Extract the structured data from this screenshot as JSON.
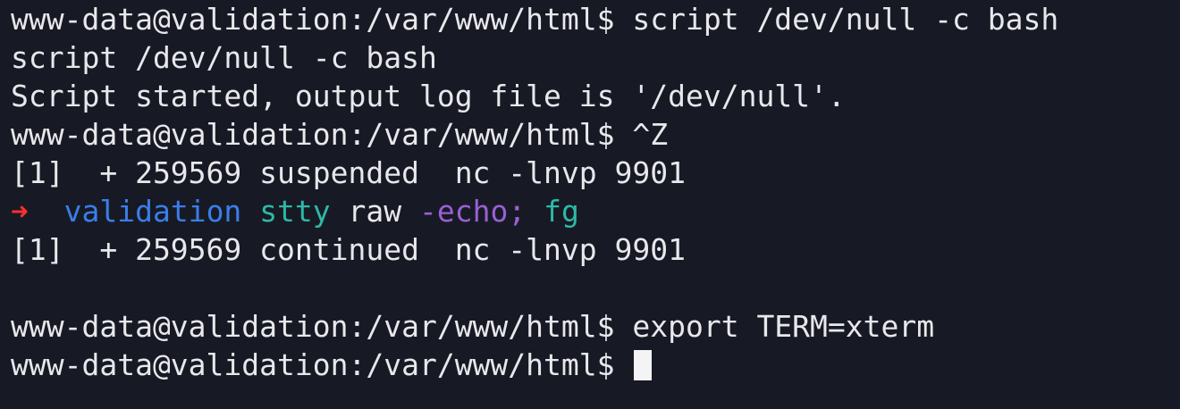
{
  "terminal": {
    "lines": [
      "www-data@validation:/var/www/html$ script /dev/null -c bash",
      "script /dev/null -c bash",
      "Script started, output log file is '/dev/null'.",
      "www-data@validation:/var/www/html$ ^Z",
      "[1]  + 259569 suspended  nc -lnvp 9901",
      "",
      "[1]  + 259569 continued  nc -lnvp 9901",
      "",
      "www-data@validation:/var/www/html$ export TERM=xterm",
      "www-data@validation:/var/www/html$ "
    ],
    "local_prompt": {
      "arrow": "➜",
      "directory": "validation",
      "command": "stty",
      "arg": "raw",
      "flag": "-echo;",
      "command2": "fg"
    },
    "colors": {
      "background": "#171a24",
      "text": "#e8e8ec",
      "arrow": "#ff2f2f",
      "directory": "#3b7dea",
      "command": "#2fb8a6",
      "flag": "#9a5fd6",
      "cursor": "#f4f4f6"
    }
  }
}
